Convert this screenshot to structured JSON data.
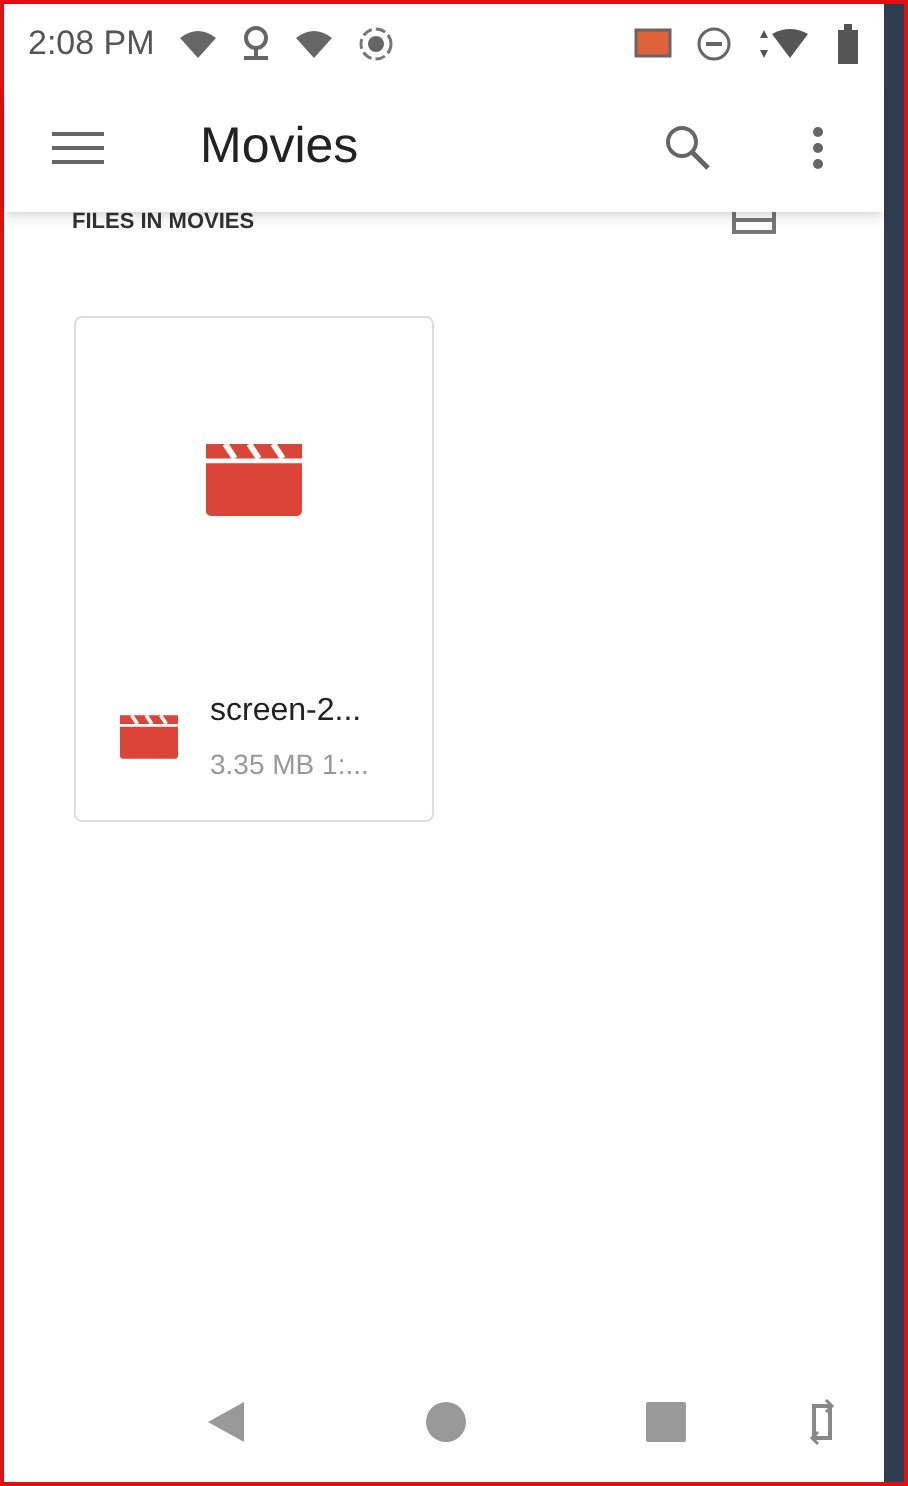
{
  "status_bar": {
    "time": "2:08 PM"
  },
  "app_bar": {
    "title": "Movies"
  },
  "section": {
    "title": "FILES IN MOVIES"
  },
  "files": [
    {
      "name": "screen-2...",
      "details": "3.35 MB 1:..."
    }
  ]
}
